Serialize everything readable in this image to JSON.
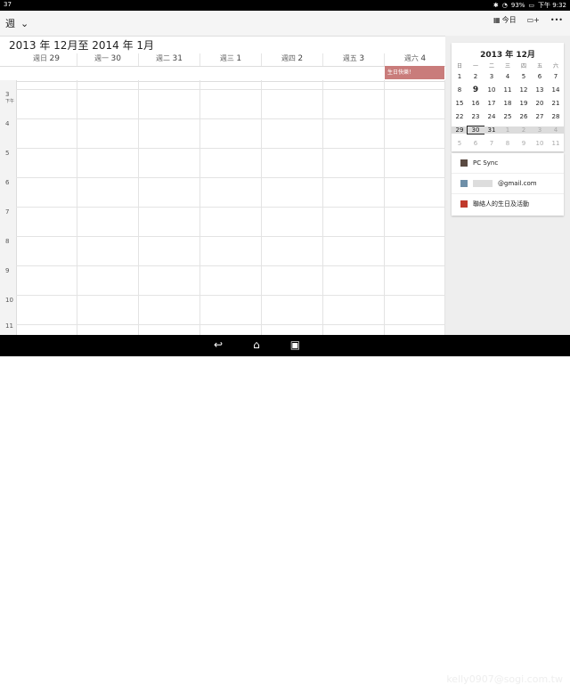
{
  "status": {
    "left": "37",
    "battery": "93%",
    "time": "下午 9:32"
  },
  "toolbar": {
    "view": "週",
    "today_label": "今日",
    "icons": [
      "today-icon",
      "new-event-icon",
      "overflow-icon"
    ]
  },
  "range_title": "2013 年 12月至 2014 年 1月",
  "days": [
    {
      "name": "週日",
      "num": "29"
    },
    {
      "name": "週一",
      "num": "30"
    },
    {
      "name": "週二",
      "num": "31"
    },
    {
      "name": "週三",
      "num": "1"
    },
    {
      "name": "週四",
      "num": "2"
    },
    {
      "name": "週五",
      "num": "3"
    },
    {
      "name": "週六",
      "num": "4"
    }
  ],
  "all_day_event": "生日快樂！",
  "hours": [
    {
      "h": "3",
      "sub": "下午"
    },
    {
      "h": "4",
      "sub": ""
    },
    {
      "h": "5",
      "sub": ""
    },
    {
      "h": "6",
      "sub": ""
    },
    {
      "h": "7",
      "sub": ""
    },
    {
      "h": "8",
      "sub": ""
    },
    {
      "h": "9",
      "sub": ""
    },
    {
      "h": "10",
      "sub": ""
    },
    {
      "h": "11",
      "sub": ""
    }
  ],
  "mini_calendar": {
    "title": "2013 年 12月",
    "weekdays": [
      "日",
      "一",
      "二",
      "三",
      "四",
      "五",
      "六"
    ],
    "rows": [
      [
        "1",
        "2",
        "3",
        "4",
        "5",
        "6",
        "7"
      ],
      [
        "8",
        "9",
        "10",
        "11",
        "12",
        "13",
        "14"
      ],
      [
        "15",
        "16",
        "17",
        "18",
        "19",
        "20",
        "21"
      ],
      [
        "22",
        "23",
        "24",
        "25",
        "26",
        "27",
        "28"
      ],
      [
        "29",
        "30",
        "31",
        "1",
        "2",
        "3",
        "4"
      ],
      [
        "5",
        "6",
        "7",
        "8",
        "9",
        "10",
        "11"
      ]
    ],
    "selected_row": 4,
    "today": "30",
    "bold_day": "9"
  },
  "calendars": [
    {
      "name": "PC Sync",
      "color": "#5a4a42"
    },
    {
      "name": "@gmail.com",
      "color": "#6e8fa8"
    },
    {
      "name": "聯絡人的生日及活動",
      "color": "#c0392b"
    }
  ],
  "watermark": "kelly0907@sogi.com.tw"
}
